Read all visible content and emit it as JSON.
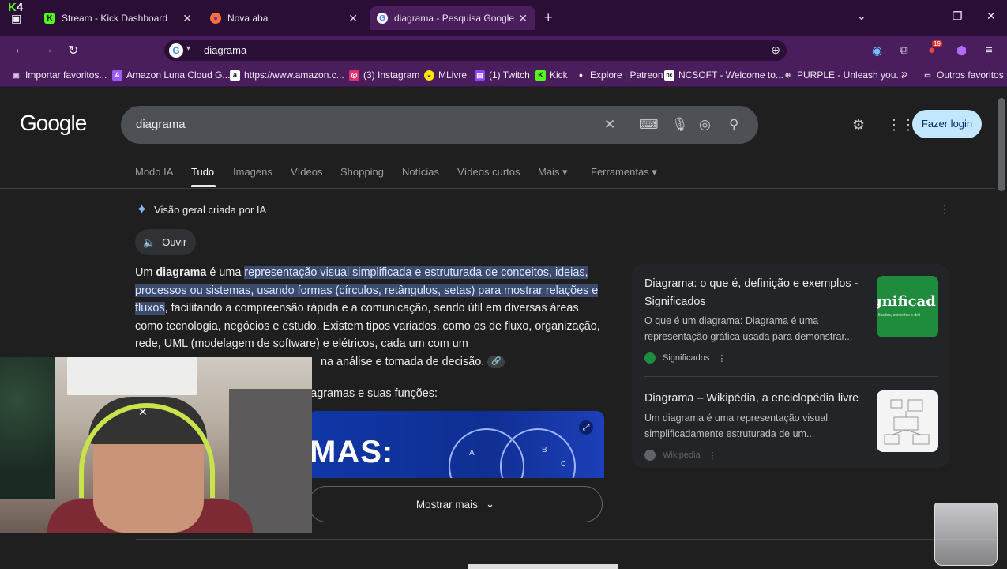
{
  "browser": {
    "tabs": [
      {
        "label": "Stream - Kick Dashboard",
        "fav": "K",
        "fav_color": "#53fc18"
      },
      {
        "label": "Nova aba",
        "fav": "●",
        "fav_color": "#ff7139"
      },
      {
        "label": "diagrama - Pesquisa Google",
        "fav": "G",
        "fav_color": "#ffffff"
      }
    ],
    "new_tab": "+",
    "url": "diagrama",
    "bookmarks": [
      {
        "label": "Importar favoritos...",
        "icon": "▣",
        "color": "#d9c5e6"
      },
      {
        "label": "Amazon Luna Cloud G...",
        "icon": "A",
        "color": "#9b5cff"
      },
      {
        "label": "https://www.amazon.c...",
        "icon": "a",
        "color": "#ffffff"
      },
      {
        "label": "(3) Instagram",
        "icon": "◎",
        "color": "#e1306c"
      },
      {
        "label": "MLivre",
        "icon": "◒",
        "color": "#ffe600"
      },
      {
        "label": "(1) Twitch",
        "icon": "▤",
        "color": "#9146ff"
      },
      {
        "label": "Kick",
        "icon": "K",
        "color": "#53fc18"
      },
      {
        "label": "Explore | Patreon",
        "icon": "●",
        "color": "#ffffff"
      },
      {
        "label": "NCSOFT - Welcome to...",
        "icon": "nc",
        "color": "#ffffff"
      },
      {
        "label": "PURPLE - Unleash you...",
        "icon": "⊕",
        "color": "#d0d0d0"
      }
    ],
    "bookmarks_more": "»",
    "other_bookmarks": "Outros favoritos",
    "notification_count": "19",
    "overlay_badge": "4"
  },
  "google": {
    "logo": "Google",
    "query": "diagrama",
    "login": "Fazer login",
    "search_tabs": [
      "Modo IA",
      "Tudo",
      "Imagens",
      "Vídeos",
      "Shopping",
      "Notícias",
      "Vídeos curtos",
      "Mais ▾",
      "Ferramentas ▾"
    ],
    "ai_overview_label": "Visão geral criada por IA",
    "listen": "Ouvir",
    "overview": {
      "p1": "Um ",
      "term": "diagrama",
      "p2": " é uma ",
      "highlight": "representação visual simplificada e estruturada de conceitos, ideias, processos ou sistemas, usando formas (círculos, retângulos, setas) para mostrar relações e fluxos",
      "p3": ", facilitando a compreensão rápida e a comunicação, sendo útil em diversas áreas como tecnologia, negócios e estudo. Existem tipos variados, como os de fluxo, organização, rede, UML (modelagem de software) e elétricos, cada um com um",
      "p4": "na análise e tomada de decisão."
    },
    "subheading": "iagramas e suas funções:",
    "image_text": "MAS:",
    "image_letters": [
      "A",
      "B",
      "C"
    ],
    "show_more": "Mostrar mais",
    "cards": [
      {
        "title": "Diagrama: o que é, definição e exemplos - Significados",
        "snippet": "O que é um diagrama: Diagrama é uma representação gráfica usada para demonstrar...",
        "source": "Significados",
        "thumb_text": "gnificad",
        "thumb_sub": "ficados, conceitos e defi"
      },
      {
        "title": "Diagrama – Wikipédia, a enciclopédia livre",
        "snippet": "Um diagrama é uma representação visual simplificadamente estruturada de um...",
        "source": "Wikipedia"
      }
    ]
  }
}
